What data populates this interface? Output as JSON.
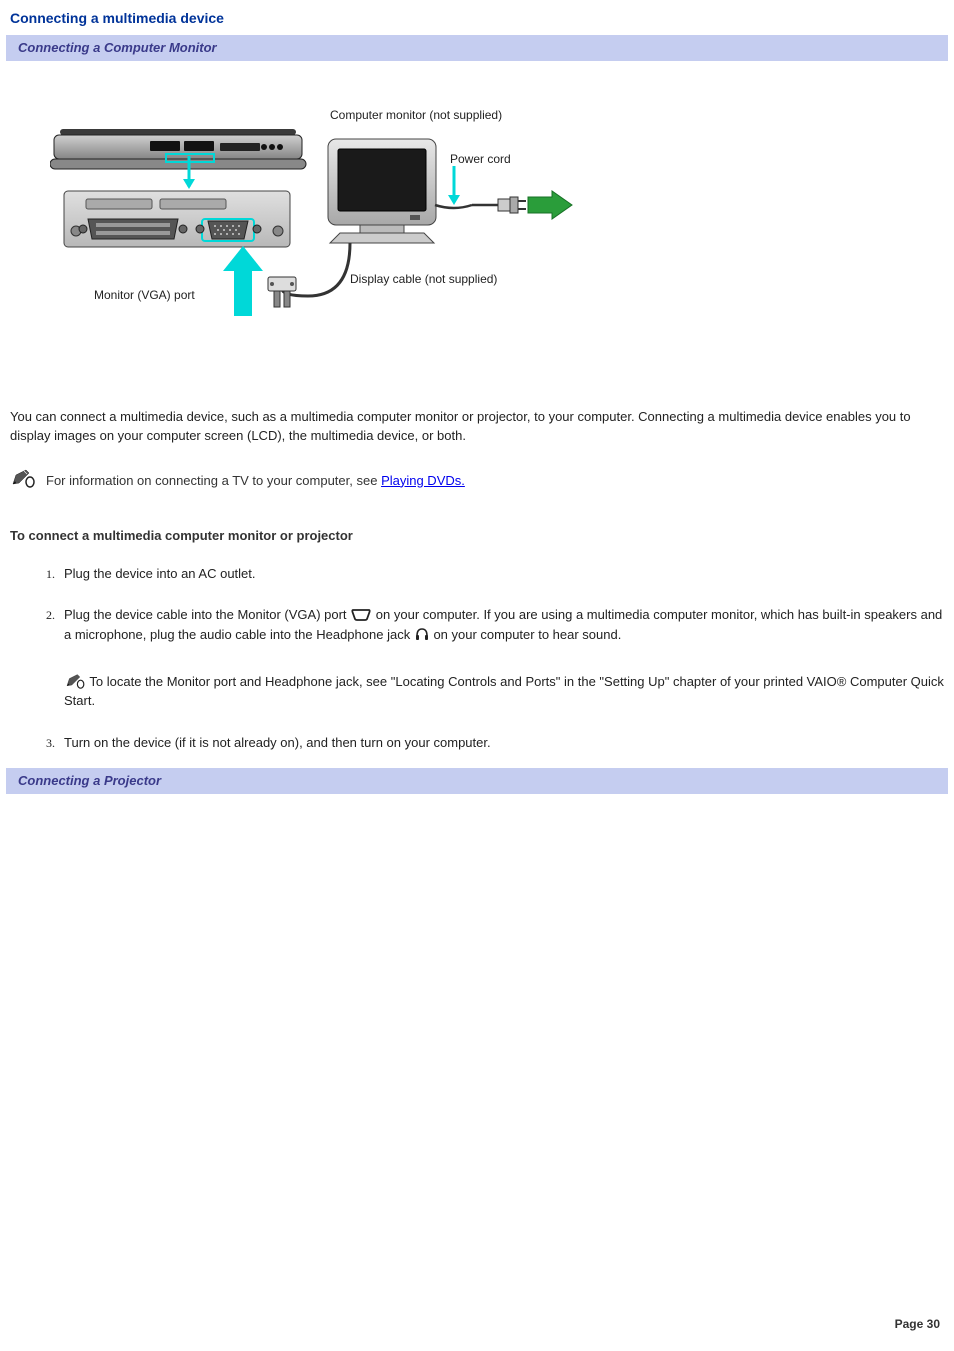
{
  "page": {
    "title": "Connecting a multimedia device",
    "sections": [
      "Connecting a Computer Monitor",
      "Connecting a Projector"
    ],
    "diagram_labels": {
      "monitor": "Computer monitor (not supplied)",
      "power_cord": "Power cord",
      "display_cable": "Display cable (not supplied)",
      "vga_port": "Monitor (VGA) port"
    },
    "intro": "You can connect a multimedia device, such as a multimedia computer monitor or projector, to your computer. Connecting a multimedia device enables you to display images on your computer screen (LCD), the multimedia device, or both.",
    "info_note_prefix": "For information on connecting a TV to your computer, see ",
    "info_note_link": "Playing DVDs.",
    "subheading": "To connect a multimedia computer monitor or projector",
    "steps": {
      "s1": "Plug the device into an AC outlet.",
      "s2a": "Plug the device cable into the Monitor (VGA) port ",
      "s2b": " on your computer. If you are using a multimedia computer monitor, which has built-in speakers and a microphone, plug the audio cable into the Headphone jack ",
      "s2c": " on your computer to hear sound.",
      "s2_note": " To locate the Monitor port and Headphone jack, see \"Locating Controls and Ports\" in the \"Setting Up\" chapter of your printed VAIO® Computer Quick Start.",
      "s3": "Turn on the device (if it is not already on), and then turn on your computer."
    },
    "footer": "Page 30"
  }
}
